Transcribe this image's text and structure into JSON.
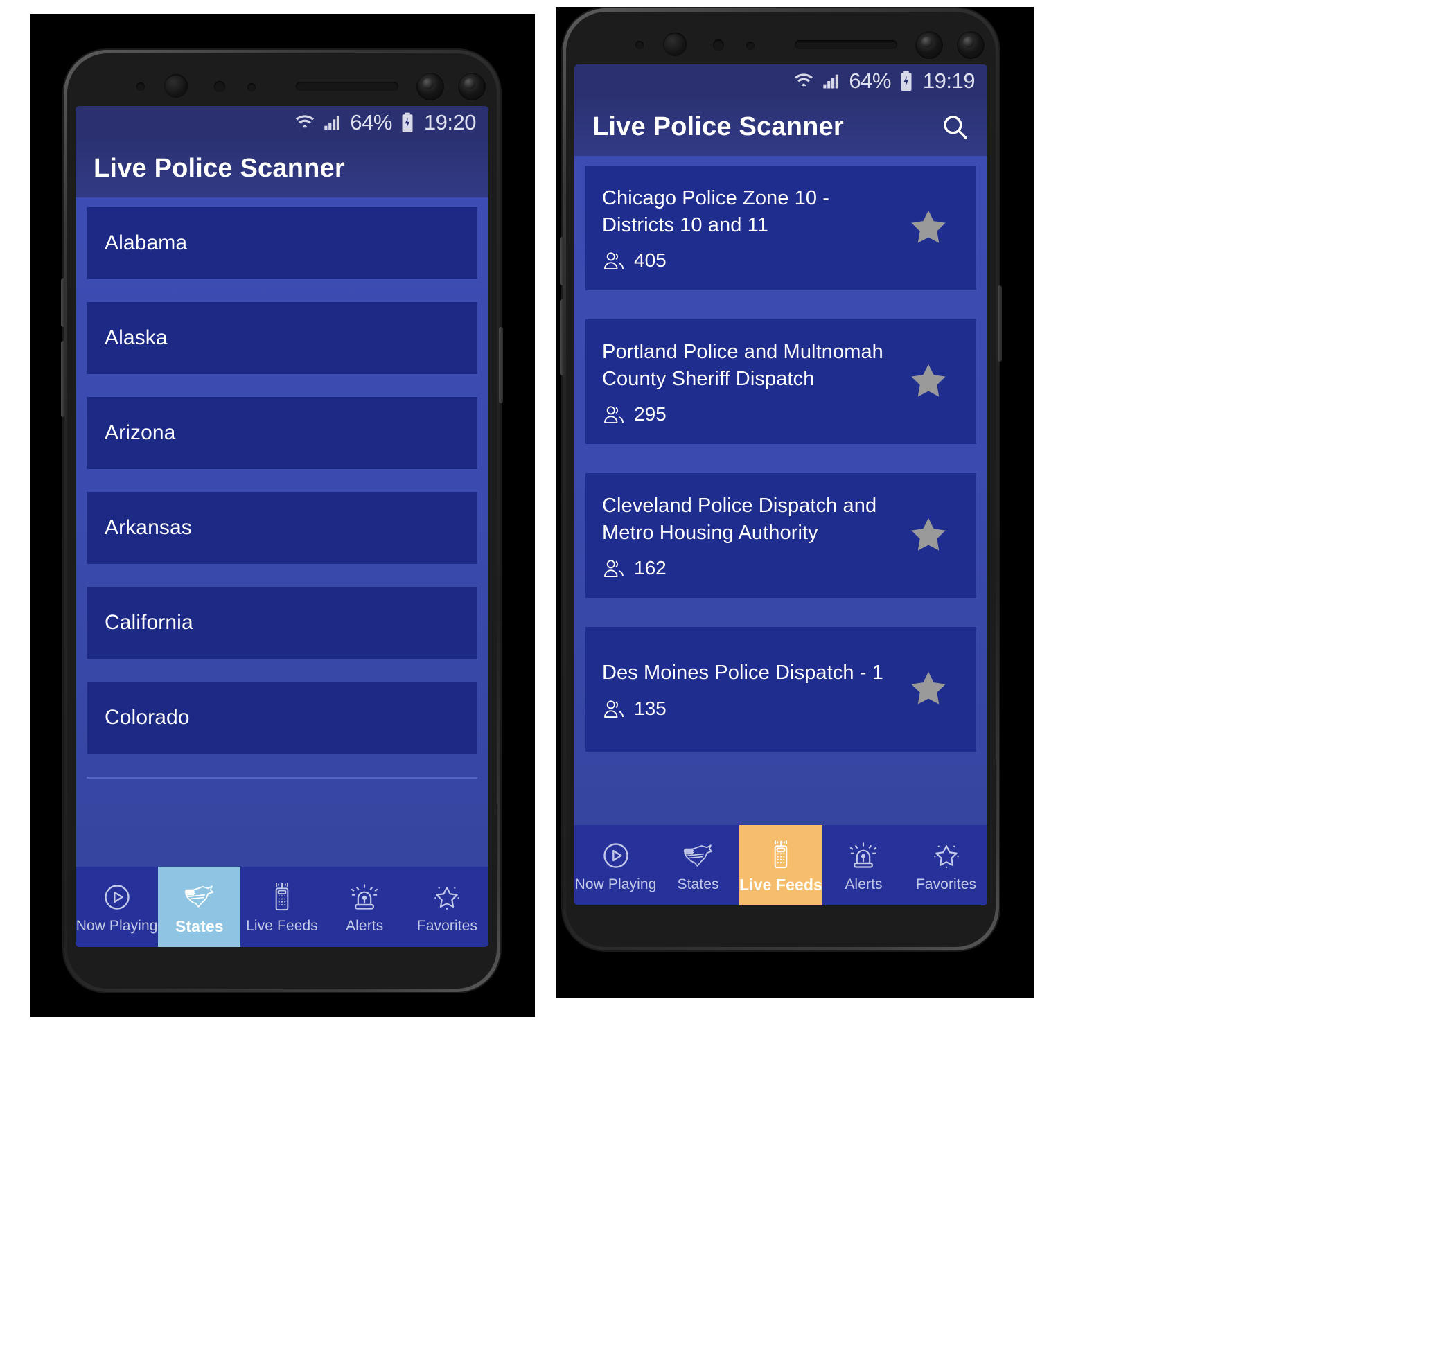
{
  "app": {
    "name": "Live Police Scanner",
    "accent_blue": "#1c2a86",
    "background_blue": "#3a4ab0",
    "active_states_color": "#8fc5e2",
    "active_livefeeds_color": "#f6bd6c",
    "star_color": "#9a9a9a"
  },
  "phones": [
    {
      "id": "left",
      "status_bar": {
        "wifi_icon": "wifi-icon",
        "signal_icon": "signal-bars-icon",
        "battery_percent": "64%",
        "battery_icon": "battery-charging-icon",
        "time": "19:20"
      },
      "app_bar": {
        "title": "Live Police Scanner",
        "has_search": false,
        "search_icon": "search-icon"
      },
      "screen_type": "states",
      "states": [
        {
          "label": "Alabama"
        },
        {
          "label": "Alaska"
        },
        {
          "label": "Arizona"
        },
        {
          "label": "Arkansas"
        },
        {
          "label": "California"
        },
        {
          "label": "Colorado"
        }
      ],
      "bottom_nav": {
        "active": "States",
        "active_style": "blue",
        "items": [
          {
            "label": "Now Playing",
            "icon": "play-circle-icon"
          },
          {
            "label": "States",
            "icon": "usa-map-icon"
          },
          {
            "label": "Live Feeds",
            "icon": "radio-scanner-icon"
          },
          {
            "label": "Alerts",
            "icon": "siren-icon"
          },
          {
            "label": "Favorites",
            "icon": "star-sparkle-icon"
          }
        ]
      }
    },
    {
      "id": "right",
      "status_bar": {
        "wifi_icon": "wifi-icon",
        "signal_icon": "signal-bars-icon",
        "battery_percent": "64%",
        "battery_icon": "battery-charging-icon",
        "time": "19:19"
      },
      "app_bar": {
        "title": "Live Police Scanner",
        "has_search": true,
        "search_icon": "search-icon"
      },
      "screen_type": "live_feeds",
      "feeds": [
        {
          "title": "Chicago Police Zone 10 - Districts 10 and 11",
          "listeners": "405",
          "listeners_icon": "listeners-icon",
          "favorite_icon": "star-icon"
        },
        {
          "title": "Portland Police and Multnomah County Sheriff Dispatch",
          "listeners": "295",
          "listeners_icon": "listeners-icon",
          "favorite_icon": "star-icon"
        },
        {
          "title": "Cleveland Police Dispatch and Metro Housing Authority",
          "listeners": "162",
          "listeners_icon": "listeners-icon",
          "favorite_icon": "star-icon"
        },
        {
          "title": "Des Moines Police Dispatch - 1",
          "listeners": "135",
          "listeners_icon": "listeners-icon",
          "favorite_icon": "star-icon"
        }
      ],
      "bottom_nav": {
        "active": "Live Feeds",
        "active_style": "orange",
        "items": [
          {
            "label": "Now Playing",
            "icon": "play-circle-icon"
          },
          {
            "label": "States",
            "icon": "usa-map-icon"
          },
          {
            "label": "Live Feeds",
            "icon": "radio-scanner-icon"
          },
          {
            "label": "Alerts",
            "icon": "siren-icon"
          },
          {
            "label": "Favorites",
            "icon": "star-sparkle-icon"
          }
        ]
      }
    }
  ]
}
